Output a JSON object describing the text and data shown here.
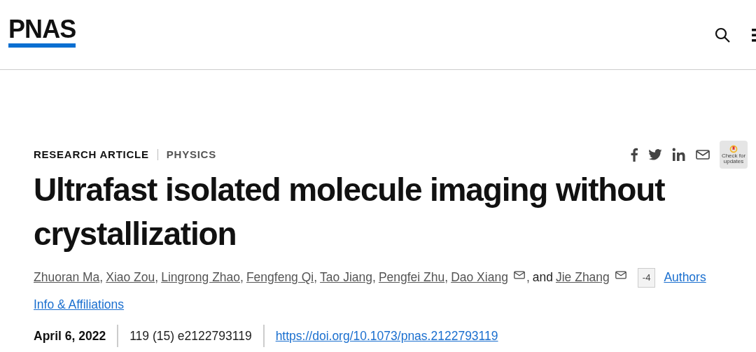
{
  "header": {
    "logo": "PNAS"
  },
  "article": {
    "type": "RESEARCH ARTICLE",
    "subject": "PHYSICS",
    "badge": "Check for updates",
    "title": "Ultrafast isolated molecule imaging without crystallization",
    "authors": [
      {
        "name": "Zhuoran Ma",
        "email": false,
        "separator": ","
      },
      {
        "name": "Xiao Zou",
        "email": false,
        "separator": ","
      },
      {
        "name": "Lingrong Zhao",
        "email": false,
        "separator": ","
      },
      {
        "name": "Fengfeng Qi",
        "email": false,
        "separator": ","
      },
      {
        "name": "Tao Jiang",
        "email": false,
        "separator": ","
      },
      {
        "name": "Pengfei Zhu",
        "email": false,
        "separator": ","
      },
      {
        "name": "Dao Xiang",
        "email": true,
        "separator": ","
      },
      {
        "name": "Jie Zhang",
        "email": true
      }
    ],
    "and": "and",
    "collapse": "-4",
    "authors_link": "Authors",
    "affiliations_link": "Info & Affiliations",
    "date": "April 6, 2022",
    "citation": "119 (15) e2122793119",
    "doi": "https://doi.org/10.1073/pnas.2122793119"
  }
}
